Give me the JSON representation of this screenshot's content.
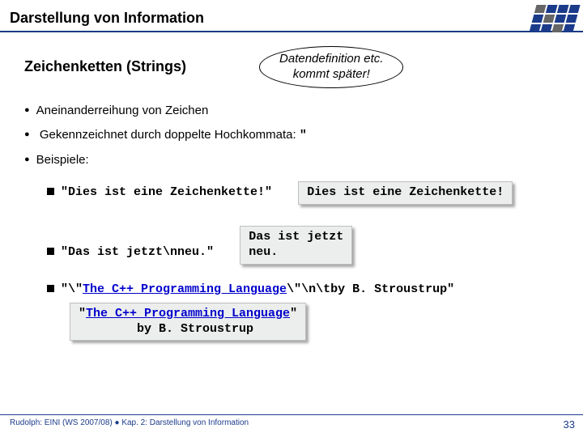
{
  "header": {
    "title": "Darstellung von Information"
  },
  "main": {
    "heading": "Zeichenketten (Strings)",
    "callout_line1": "Datendefinition etc.",
    "callout_line2": "kommt später!",
    "bullet1": "Aneinanderreihung von Zeichen",
    "bullet2_pre": "Gekennzeichnet durch doppelte Hochkommata: ",
    "bullet2_char": "\"",
    "bullet3": "Beispiele:",
    "ex1_code": "\"Dies ist eine Zeichenkette!\"",
    "ex1_output": "Dies ist eine Zeichenkette!",
    "ex2_code": "\"Das ist jetzt\\nneu.\"",
    "ex2_output": "Das ist jetzt\nneu.",
    "ex3_q1": "\"\\\"",
    "ex3_link": "The C++ Programming Language",
    "ex3_q2": "\\\"\\n\\tby B. Stroustrup\"",
    "ex3_out_q1": "\"",
    "ex3_out_link": "The C++ Programming Language",
    "ex3_out_q2": "\"",
    "ex3_out_line2": "        by B. Stroustrup"
  },
  "footer": {
    "left": "Rudolph: EINI (WS 2007/08)  ●  Kap. 2: Darstellung von Information",
    "page": "33"
  }
}
